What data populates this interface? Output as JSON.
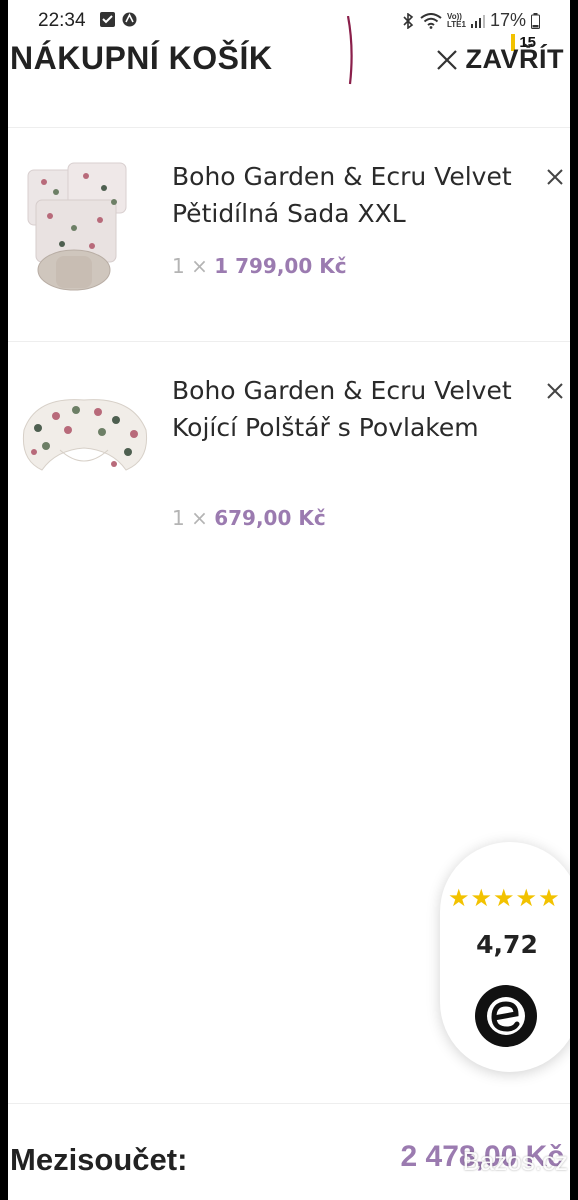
{
  "status_bar": {
    "time": "22:34",
    "battery": "17%",
    "network_label_1": "Vo))",
    "network_label_2": "LTE1"
  },
  "header": {
    "title": "NÁKUPNÍ KOŠÍK",
    "close_label": "ZAVŘÍT",
    "notification_count": "15"
  },
  "cart": {
    "items": [
      {
        "name": "Boho Garden & Ecru Velvet Pětidílná Sada XXL",
        "quantity": "1 ×",
        "price": "1 799,00 Kč"
      },
      {
        "name": "Boho Garden & Ecru Velvet Kojící Polštář s Povlakem",
        "quantity": "1 ×",
        "price": "679,00 Kč"
      }
    ]
  },
  "rating_widget": {
    "stars": "★★★★★",
    "stars_value": 5,
    "score": "4,72"
  },
  "footer": {
    "subtotal_label": "Mezisoučet:",
    "subtotal_value": "2 478,00 Kč",
    "watermark": "Bazos.cz"
  },
  "colors": {
    "accent": "#9b7bb0",
    "star": "#f2c200",
    "text": "#222222"
  }
}
